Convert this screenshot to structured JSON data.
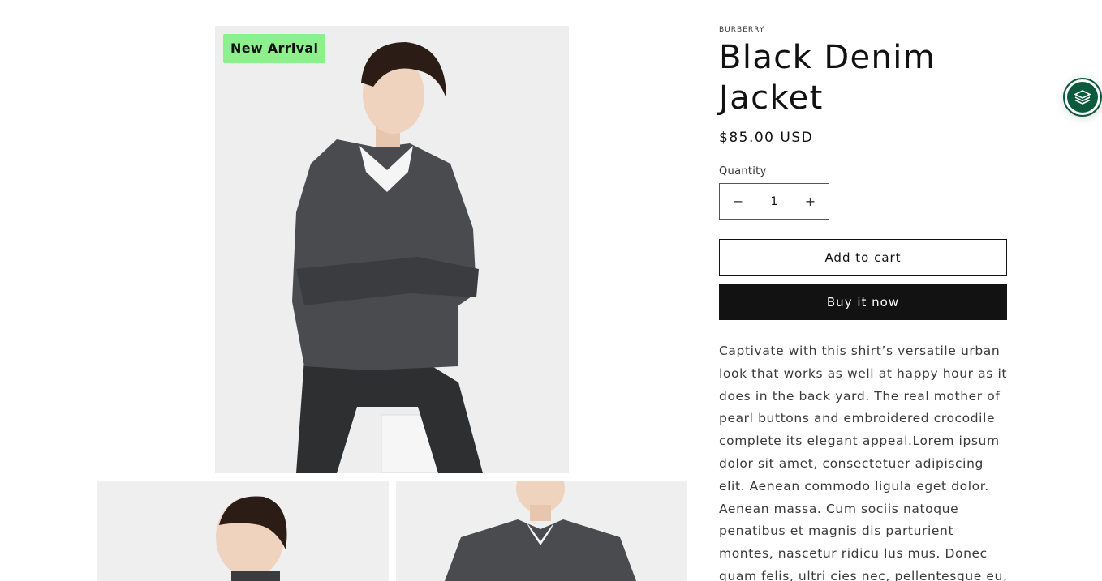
{
  "badge": {
    "label": "New Arrival",
    "color": "#8cf08c"
  },
  "product": {
    "vendor": "BURBERRY",
    "title": "Black Denim Jacket",
    "price": "$85.00 USD",
    "quantity_label": "Quantity",
    "quantity_value": "1",
    "decrease_symbol": "−",
    "increase_symbol": "+",
    "add_to_cart": "Add to cart",
    "buy_now": "Buy it now",
    "description": "Captivate with this shirt’s versatile urban look that works as well at happy hour as it does in the back yard. The real mother of pearl buttons and embroidered crocodile complete its elegant appeal.Lorem ipsum dolor sit amet, consectetuer adipiscing elit. Aenean commodo ligula eget dolor. Aenean massa. Cum sociis natoque penatibus et magnis dis parturient montes, nascetur ridicu lus mus. Donec quam felis, ultri cies nec, pellentesque eu,"
  },
  "widget": {
    "icon": "box-stack-icon",
    "color": "#0b5a3e"
  },
  "colors": {
    "text": "#121212",
    "buy_button_bg": "#121212",
    "image_bg": "#eeeeee"
  }
}
